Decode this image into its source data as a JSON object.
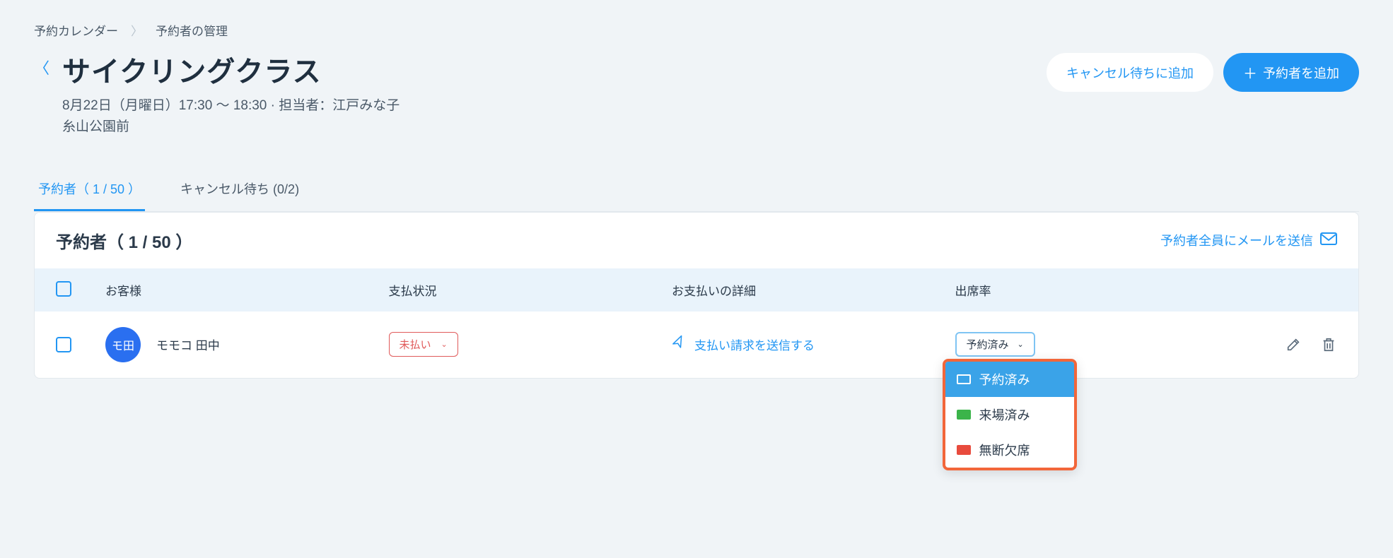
{
  "breadcrumb": {
    "calendar": "予約カレンダー",
    "manage": "予約者の管理"
  },
  "header": {
    "title": "サイクリングクラス",
    "datetime": "8月22日（月曜日）17:30 〜 18:30 · 担当者：江戸みな子",
    "location": "糸山公園前",
    "waitlist_btn": "キャンセル待ちに追加",
    "add_btn": "予約者を追加"
  },
  "tabs": {
    "attendees": "予約者（ 1 / 50 ）",
    "waitlist": "キャンセル待ち (0/2)"
  },
  "card": {
    "title": "予約者（ 1 / 50 ）",
    "email_all": "予約者全員にメールを送信"
  },
  "columns": {
    "customer": "お客様",
    "payment_status": "支払状況",
    "payment_detail": "お支払いの詳細",
    "attendance": "出席率"
  },
  "row": {
    "avatar_label": "モ田",
    "name": "モモコ 田中",
    "payment_badge": "未払い",
    "send_request": "支払い請求を送信する",
    "attendance_value": "予約済み"
  },
  "dropdown": {
    "reserved": "予約済み",
    "attended": "来場済み",
    "noshow": "無断欠席"
  }
}
